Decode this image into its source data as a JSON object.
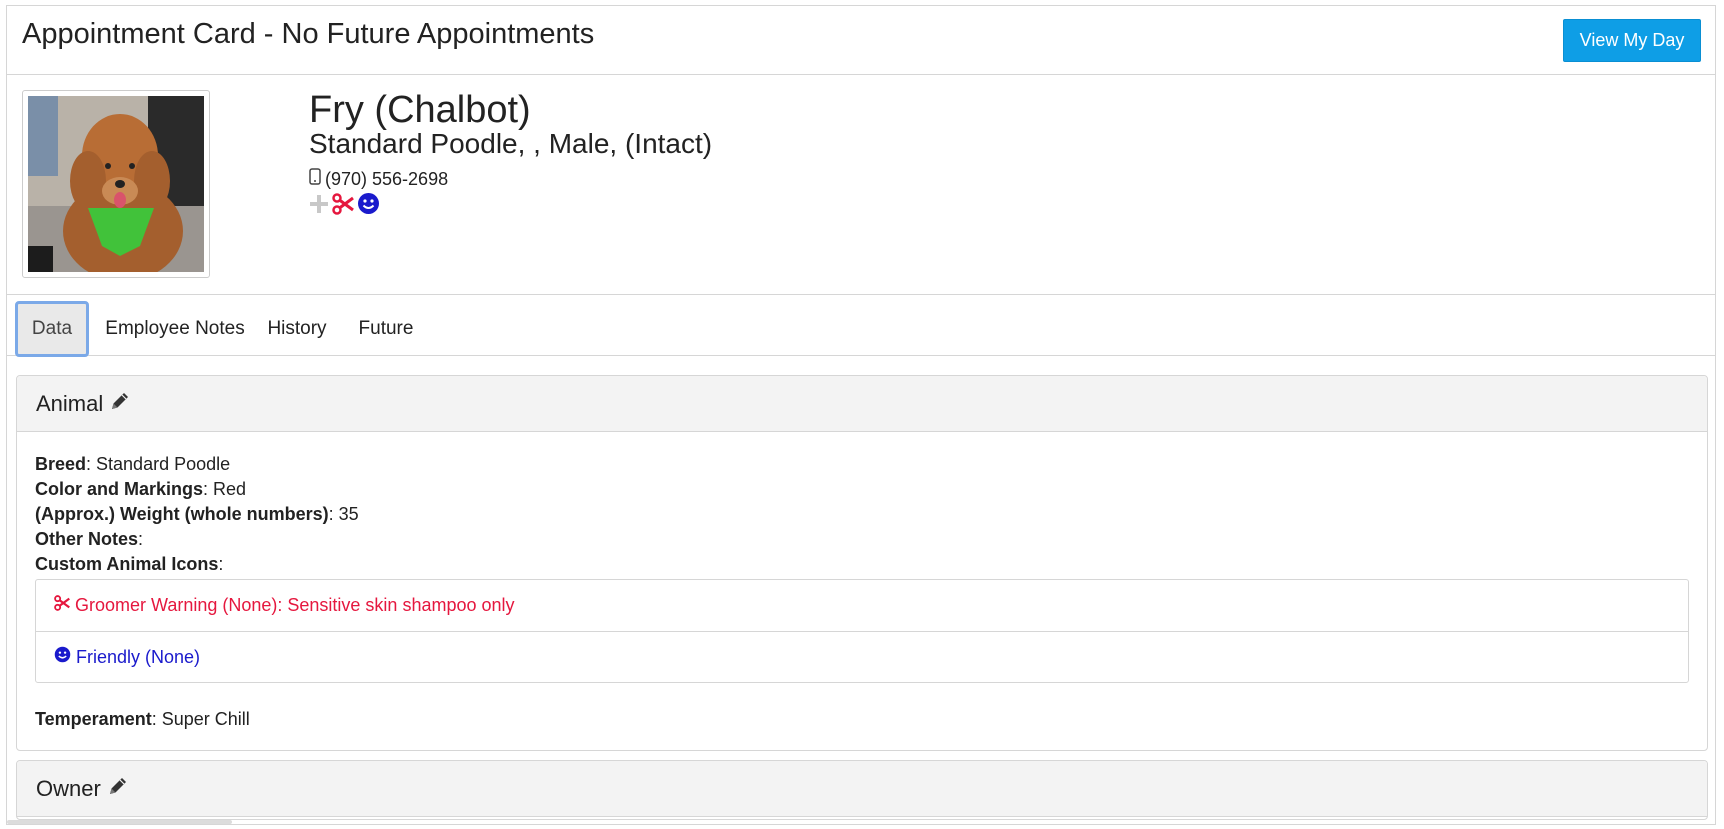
{
  "header": {
    "title": "Appointment Card - No Future Appointments",
    "view_day_label": "View My Day"
  },
  "pet": {
    "name": "Fry (Chalbot)",
    "description": "Standard Poodle, , Male, (Intact)",
    "phone": "(970) 556-2698",
    "status_icons": [
      "plus-icon",
      "scissors-icon",
      "smiley-icon"
    ]
  },
  "tabs": [
    {
      "label": "Data",
      "active": true
    },
    {
      "label": "Employee Notes",
      "active": false
    },
    {
      "label": "History",
      "active": false
    },
    {
      "label": "Future",
      "active": false
    }
  ],
  "animal_panel": {
    "title": "Animal",
    "fields": [
      {
        "label": "Breed",
        "value": ": Standard Poodle"
      },
      {
        "label": "Color and Markings",
        "value": ": Red"
      },
      {
        "label": "(Approx.) Weight (whole numbers)",
        "value": ": 35"
      },
      {
        "label": "Other Notes",
        "value": ":"
      },
      {
        "label": "Custom Animal Icons",
        "value": ":"
      }
    ],
    "custom_icons": [
      {
        "text": "Groomer Warning (None): Sensitive skin shampoo only",
        "icon": "scissors-icon",
        "color": "#e5173e"
      },
      {
        "text": "Friendly (None)",
        "icon": "smiley-icon",
        "color": "#1a1acc"
      }
    ],
    "temperament_label": "Temperament",
    "temperament_value": ": Super Chill"
  },
  "owner_panel": {
    "title": "Owner"
  },
  "colors": {
    "accent": "#0e9ee6",
    "warning": "#e5173e",
    "friendly": "#1a1acc"
  }
}
